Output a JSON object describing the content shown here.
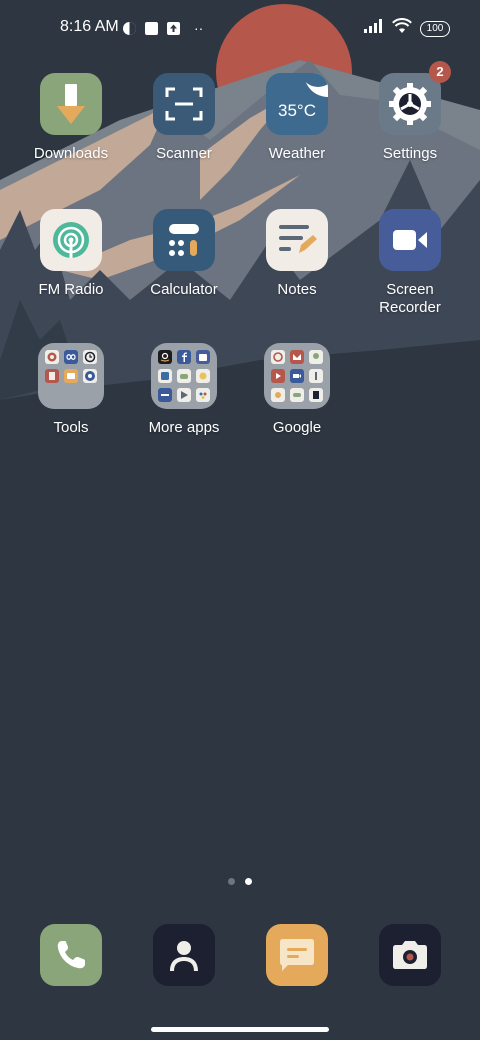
{
  "status_bar": {
    "time": "8:16 AM",
    "battery": "100",
    "more": "··"
  },
  "apps_row1": [
    {
      "label": "Downloads",
      "icon": "download-icon",
      "color": "#8ba57a"
    },
    {
      "label": "Scanner",
      "icon": "scan-icon",
      "color": "#3b5a78"
    },
    {
      "label": "Weather",
      "icon": "weather-icon",
      "color": "#3d6a8e",
      "temp": "35°C"
    },
    {
      "label": "Settings",
      "icon": "gear-icon",
      "color": "#6a7a88",
      "badge": "2"
    }
  ],
  "apps_row2": [
    {
      "label": "FM Radio",
      "icon": "radio-icon",
      "color": "#f1ece6"
    },
    {
      "label": "Calculator",
      "icon": "calculator-icon",
      "color": "#355a7a"
    },
    {
      "label": "Notes",
      "icon": "notes-icon",
      "color": "#f1ece6"
    },
    {
      "label": "Screen\nRecorder",
      "icon": "video-icon",
      "color": "#465d9a"
    }
  ],
  "folders": [
    {
      "label": "Tools"
    },
    {
      "label": "More apps"
    },
    {
      "label": "Google"
    }
  ],
  "dock": [
    {
      "name": "phone",
      "icon": "phone-icon",
      "color": "#8ba57a"
    },
    {
      "name": "contacts",
      "icon": "person-icon",
      "color": "#1c2030"
    },
    {
      "name": "messages",
      "icon": "message-icon",
      "color": "#e5a95b"
    },
    {
      "name": "camera",
      "icon": "camera-icon",
      "color": "#1c2030"
    }
  ],
  "page_indicator": {
    "pages": 2,
    "current": 2
  }
}
